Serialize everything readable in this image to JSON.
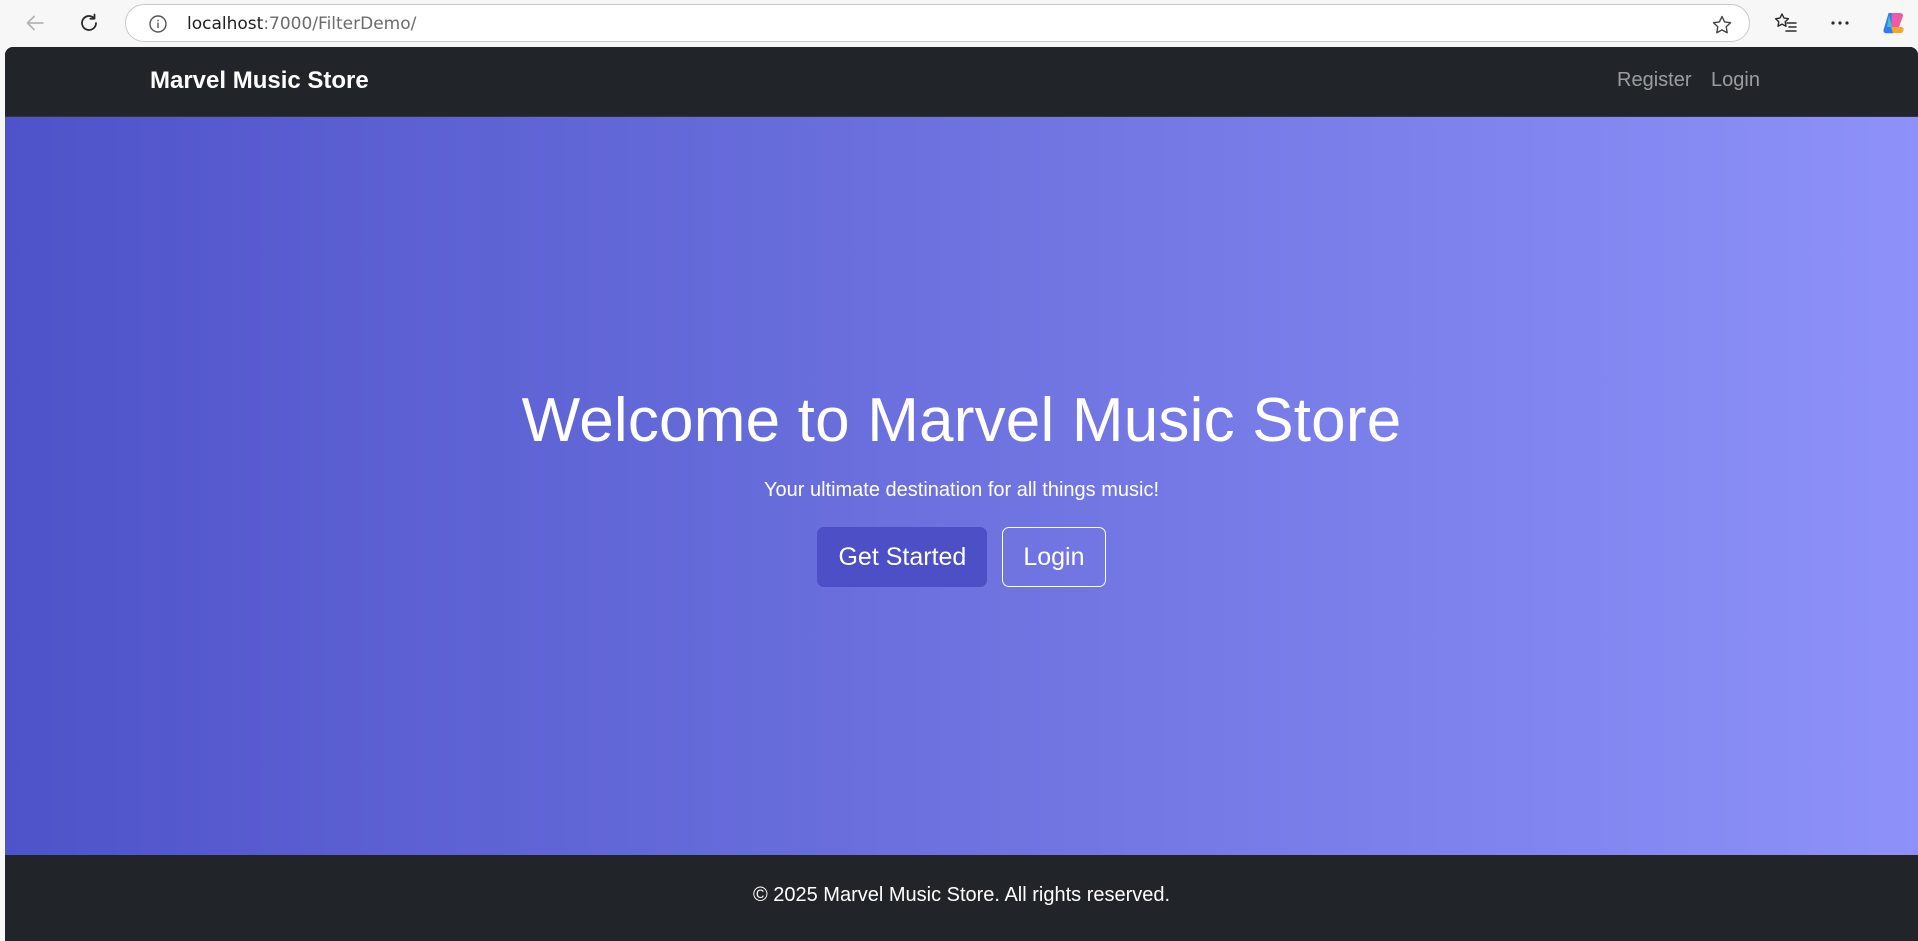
{
  "browser": {
    "url_host": "localhost",
    "url_path": ":7000/FilterDemo/"
  },
  "nav": {
    "brand": "Marvel Music Store",
    "links": [
      "Register",
      "Login"
    ]
  },
  "hero": {
    "title": "Welcome to Marvel Music Store",
    "subtitle": "Your ultimate destination for all things music!",
    "primary_button": "Get Started",
    "secondary_button": "Login"
  },
  "footer": {
    "text": "© 2025 Marvel Music Store. All rights reserved."
  },
  "colors": {
    "nav_bg": "#212529",
    "hero_gradient_start": "#4f53c9",
    "hero_gradient_end": "#8d91f9",
    "primary_button": "#4c4fc6"
  }
}
